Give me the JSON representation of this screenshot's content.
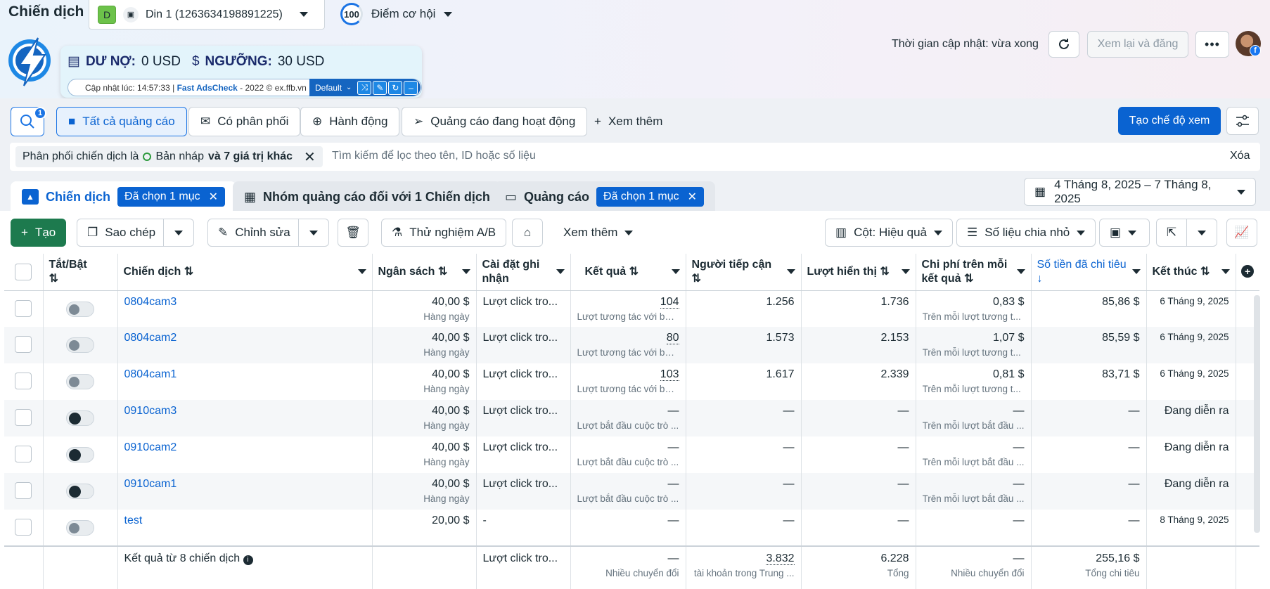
{
  "page_title": "Chiến dịch",
  "account": {
    "badge": "D",
    "name": "Din 1 (1263634198891225)"
  },
  "opportunity": {
    "score": "100",
    "label": "Điểm cơ hội"
  },
  "extension": {
    "debt_label": "DƯ NỢ:",
    "debt_value": "0 USD",
    "threshold_label": "NGƯỠNG:",
    "threshold_value": "30 USD",
    "updated_text": "Cập nhật lúc: 14:57:33 |",
    "brand": "Fast AdsCheck",
    "brand_suffix": "- 2022 © ex.ffb.vn",
    "profile": "Default"
  },
  "topbar": {
    "update_time": "Thời gian cập nhật: vừa xong",
    "review_publish": "Xem lại và đăng"
  },
  "filters": {
    "search_badge": "1",
    "all_ads": "Tất cả quảng cáo",
    "delivering": "Có phân phối",
    "actions": "Hành động",
    "active_ads": "Quảng cáo đang hoạt động",
    "see_more": "Xem thêm",
    "create_view": "Tạo chế độ xem"
  },
  "filter_chip": {
    "text_a": "Phân phối chiến dịch là",
    "text_b": "Bản nháp",
    "text_c": "và 7 giá trị khác"
  },
  "filter_search_placeholder": "Tìm kiếm để lọc theo tên, ID hoặc số liệu",
  "clear": "Xóa",
  "tabs": {
    "campaigns": "Chiến dịch",
    "campaigns_sel": "Đã chọn 1 mục",
    "adsets": "Nhóm quảng cáo đối với 1 Chiến dịch",
    "ads": "Quảng cáo",
    "ads_sel": "Đã chọn 1 mục"
  },
  "date_range": "4 Tháng 8, 2025 – 7 Tháng 8, 2025",
  "toolbar": {
    "create": "Tạo",
    "copy": "Sao chép",
    "edit": "Chỉnh sửa",
    "ab_test": "Thử nghiệm A/B",
    "more": "Xem thêm",
    "columns": "Cột: Hiệu quả",
    "breakdown": "Số liệu chia nhỏ"
  },
  "columns": {
    "toggle": "Tắt/Bật",
    "campaign": "Chiến dịch",
    "budget": "Ngân sách",
    "attribution": "Cài đặt ghi nhận",
    "results": "Kết quả",
    "reach": "Người tiếp cận",
    "impressions": "Lượt hiển thị",
    "cost_per_result": "Chi phí trên mỗi kết quả",
    "amount_spent": "Số tiền đã chi tiêu",
    "ends": "Kết thúc"
  },
  "rows": [
    {
      "name": "0804cam3",
      "budget": "40,00 $",
      "budget_sub": "Hàng ngày",
      "attribution": "Lượt click tro...",
      "results": "104",
      "results_sub": "Lượt tương tác với bài...",
      "reach": "1.256",
      "impressions": "1.736",
      "cpr": "0,83 $",
      "cpr_sub": "Trên mỗi lượt tương t...",
      "spent": "85,86 $",
      "ends": "6 Tháng 9, 2025",
      "on": false
    },
    {
      "name": "0804cam2",
      "budget": "40,00 $",
      "budget_sub": "Hàng ngày",
      "attribution": "Lượt click tro...",
      "results": "80",
      "results_sub": "Lượt tương tác với bài...",
      "reach": "1.573",
      "impressions": "2.153",
      "cpr": "1,07 $",
      "cpr_sub": "Trên mỗi lượt tương t...",
      "spent": "85,59 $",
      "ends": "6 Tháng 9, 2025",
      "on": false
    },
    {
      "name": "0804cam1",
      "budget": "40,00 $",
      "budget_sub": "Hàng ngày",
      "attribution": "Lượt click tro...",
      "results": "103",
      "results_sub": "Lượt tương tác với bài...",
      "reach": "1.617",
      "impressions": "2.339",
      "cpr": "0,81 $",
      "cpr_sub": "Trên mỗi lượt tương t...",
      "spent": "83,71 $",
      "ends": "6 Tháng 9, 2025",
      "on": false
    },
    {
      "name": "0910cam3",
      "budget": "40,00 $",
      "budget_sub": "Hàng ngày",
      "attribution": "Lượt click tro...",
      "results": "—",
      "results_sub": "Lượt bắt đầu cuộc trò ...",
      "reach": "—",
      "impressions": "—",
      "cpr": "—",
      "cpr_sub": "Trên mỗi lượt bắt đầu ...",
      "spent": "—",
      "ends": "Đang diễn ra",
      "on": true
    },
    {
      "name": "0910cam2",
      "budget": "40,00 $",
      "budget_sub": "Hàng ngày",
      "attribution": "Lượt click tro...",
      "results": "—",
      "results_sub": "Lượt bắt đầu cuộc trò ...",
      "reach": "—",
      "impressions": "—",
      "cpr": "—",
      "cpr_sub": "Trên mỗi lượt bắt đầu ...",
      "spent": "—",
      "ends": "Đang diễn ra",
      "on": true
    },
    {
      "name": "0910cam1",
      "budget": "40,00 $",
      "budget_sub": "Hàng ngày",
      "attribution": "Lượt click tro...",
      "results": "—",
      "results_sub": "Lượt bắt đầu cuộc trò ...",
      "reach": "—",
      "impressions": "—",
      "cpr": "—",
      "cpr_sub": "Trên mỗi lượt bắt đầu ...",
      "spent": "—",
      "ends": "Đang diễn ra",
      "on": true
    },
    {
      "name": "test",
      "budget": "20,00 $",
      "budget_sub": "",
      "attribution": "-",
      "results": "—",
      "results_sub": "",
      "reach": "—",
      "impressions": "—",
      "cpr": "—",
      "cpr_sub": "",
      "spent": "—",
      "ends": "8 Tháng 9, 2025",
      "on": false
    }
  ],
  "footer": {
    "label": "Kết quả từ 8 chiến dịch",
    "attribution": "Lượt click tro...",
    "results": "—",
    "results_sub": "Nhiều chuyển đổi",
    "reach": "3.832",
    "reach_sub": "tài khoản trong Trung ...",
    "impressions": "6.228",
    "impressions_sub": "Tổng",
    "cpr": "—",
    "cpr_sub": "Nhiều chuyển đổi",
    "spent": "255,16 $",
    "spent_sub": "Tổng chi tiêu"
  }
}
